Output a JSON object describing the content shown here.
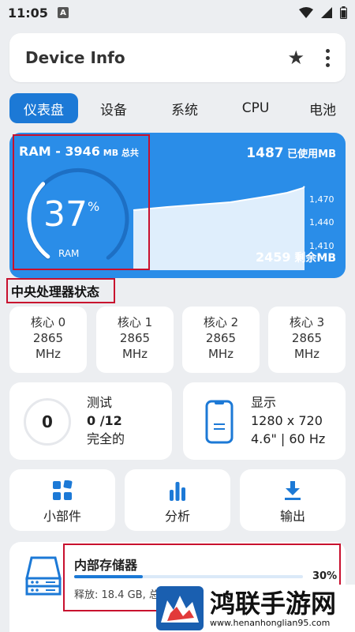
{
  "status_bar": {
    "time": "11:05",
    "badge": "A"
  },
  "appbar": {
    "title": "Device Info"
  },
  "tabs": [
    "仪表盘",
    "设备",
    "系统",
    "CPU",
    "电池"
  ],
  "ram": {
    "title_prefix": "RAM - ",
    "total_value": "3946",
    "total_unit": " MB 总共",
    "percent": "37",
    "percent_sign": "%",
    "gauge_label": "RAM",
    "used_value": "1487",
    "used_unit": " 已使用MB",
    "free_value": "2459",
    "free_unit": " 剩余MB",
    "chart_ticks": [
      "1,470",
      "1,440",
      "1,410"
    ],
    "gauge_fraction": 0.37
  },
  "cpu_section": {
    "title": "中央处理器状态",
    "cores": [
      {
        "name": "核心 0",
        "freq": "2865",
        "unit": "MHz"
      },
      {
        "name": "核心 1",
        "freq": "2865",
        "unit": "MHz"
      },
      {
        "name": "核心 2",
        "freq": "2865",
        "unit": "MHz"
      },
      {
        "name": "核心 3",
        "freq": "2865",
        "unit": "MHz"
      }
    ]
  },
  "test_card": {
    "count": "0",
    "title": "测试",
    "progress": "0 /12",
    "status": "完全的"
  },
  "display_card": {
    "title": "显示",
    "resolution": "1280 x 720",
    "details": "4.6\" | 60 Hz"
  },
  "actions": [
    {
      "label": "小部件",
      "icon": "widgets-icon"
    },
    {
      "label": "分析",
      "icon": "bar-chart-icon"
    },
    {
      "label": "输出",
      "icon": "download-icon"
    }
  ],
  "storage": {
    "title": "内部存储器",
    "percent": "30%",
    "free": "释放: 18.4 GB, 总",
    "fraction": 0.3
  },
  "watermark": {
    "title": "鸿联手游网",
    "url": "www.henanhonglian95.com"
  },
  "colors": {
    "accent": "#1c79d6",
    "ram_card": "#2a8de8",
    "highlight_box": "#c8102e"
  }
}
